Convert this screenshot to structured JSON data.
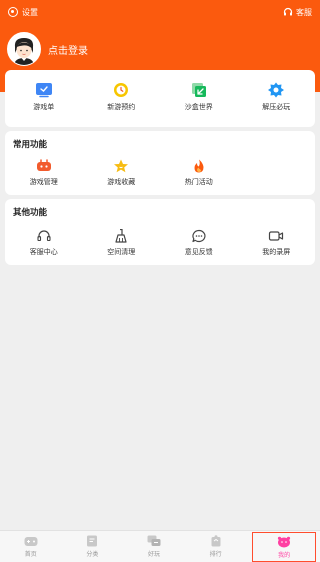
{
  "topbar": {
    "settings_label": "设置",
    "service_label": "客服"
  },
  "profile": {
    "login_text": "点击登录"
  },
  "quick_access": {
    "items": [
      {
        "label": "游戏单",
        "icon": "game-list-icon",
        "color": "#3f86f5"
      },
      {
        "label": "新游预约",
        "icon": "clock-icon",
        "color": "#f7c600"
      },
      {
        "label": "沙盒世界",
        "icon": "sandbox-icon",
        "color": "#16b95b"
      },
      {
        "label": "解压必玩",
        "icon": "gear-icon",
        "color": "#2196f3"
      }
    ]
  },
  "common": {
    "title": "常用功能",
    "items": [
      {
        "label": "游戏管理",
        "icon": "gamepad-icon",
        "color": "#f25b2d"
      },
      {
        "label": "游戏收藏",
        "icon": "star-icon",
        "color": "#f7bc12"
      },
      {
        "label": "热门活动",
        "icon": "flame-icon",
        "color": "#fb5a0e"
      }
    ]
  },
  "other": {
    "title": "其他功能",
    "items": [
      {
        "label": "客服中心",
        "icon": "headset-icon"
      },
      {
        "label": "空间清理",
        "icon": "broom-icon"
      },
      {
        "label": "意见反馈",
        "icon": "chat-bubble-icon"
      },
      {
        "label": "我的录屏",
        "icon": "video-camera-icon"
      }
    ]
  },
  "bottom_nav": {
    "items": [
      {
        "label": "首页",
        "icon": "gamepad-icon"
      },
      {
        "label": "分类",
        "icon": "category-icon"
      },
      {
        "label": "好玩",
        "icon": "fun-icon"
      },
      {
        "label": "排行",
        "icon": "ranking-icon"
      },
      {
        "label": "我的",
        "icon": "profile-face-icon",
        "active": true
      }
    ]
  },
  "colors": {
    "header_orange": "#fb5a0e",
    "active_pink": "#ff3fa2",
    "page_background": "#efefef"
  }
}
